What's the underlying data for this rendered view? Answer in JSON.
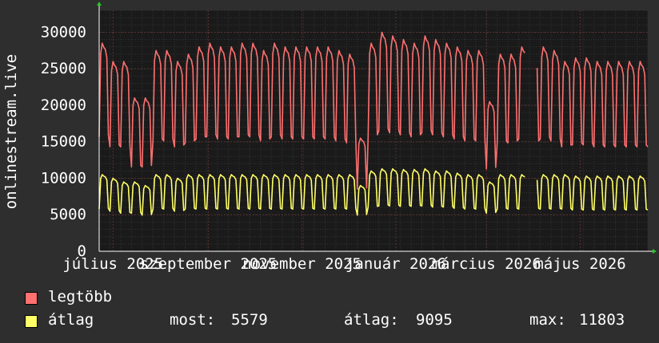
{
  "chart_data": {
    "type": "line",
    "ylabel": "onlinestream.live",
    "ylim": [
      0,
      33000
    ],
    "yticks": [
      0,
      5000,
      10000,
      15000,
      20000,
      25000,
      30000
    ],
    "ytick_labels": [
      "0",
      "5000",
      "10000",
      "15000",
      "20000",
      "25000",
      "30000"
    ],
    "xticks": [
      {
        "label": "július 2025",
        "date": "2025-07-01"
      },
      {
        "label": "szeptember 2025",
        "date": "2025-09-01"
      },
      {
        "label": "november 2025",
        "date": "2025-11-01"
      },
      {
        "label": "január 2026",
        "date": "2026-01-01"
      },
      {
        "label": "március 2026",
        "date": "2026-03-01"
      },
      {
        "label": "május 2026",
        "date": "2026-05-01"
      }
    ],
    "xrange": [
      "2025-06-22",
      "2026-06-14"
    ],
    "grid": true,
    "series": [
      {
        "name": "legtöbb",
        "color": "#ff7070",
        "weekly_peak_values": [
          28500,
          26000,
          26000,
          21000,
          21000,
          27500,
          27500,
          26000,
          27000,
          28000,
          28500,
          28000,
          28000,
          28500,
          28500,
          27500,
          28500,
          28000,
          28000,
          28000,
          28000,
          28000,
          27500,
          27000,
          15500,
          28500,
          30000,
          29500,
          29000,
          28500,
          29500,
          29000,
          28500,
          28000,
          27500,
          27500,
          20500,
          27000,
          27000,
          28000,
          27000,
          28000,
          27500,
          26000,
          26500,
          26500,
          26000
        ]
      },
      {
        "name": "átlag",
        "color": "#ffff66",
        "weekly_peak_values": [
          10500,
          10000,
          9500,
          9500,
          9000,
          10500,
          10500,
          10000,
          10500,
          10500,
          10500,
          10500,
          10500,
          10500,
          10500,
          10500,
          10500,
          10500,
          10500,
          10500,
          10500,
          10500,
          10500,
          10500,
          9000,
          11000,
          11300,
          11300,
          11200,
          11200,
          11300,
          11000,
          11000,
          10700,
          10500,
          10500,
          9500,
          10500,
          10500,
          10500,
          10500,
          10500,
          10500,
          10500,
          10300,
          10300,
          10300
        ]
      }
    ]
  },
  "legend": {
    "max_label": "legtöbb",
    "avg_label": "átlag",
    "stats": {
      "now_label": "most:",
      "now_value": "5579",
      "avg_label": "átlag:",
      "avg_value": "9095",
      "max_label": "max:",
      "max_value": "11803"
    }
  },
  "colors": {
    "background": "#2e2e2e",
    "plot": "#1a1a1a",
    "grid": "#3c3c3c",
    "max_line": "#ff7070",
    "avg_line": "#ffff66"
  }
}
